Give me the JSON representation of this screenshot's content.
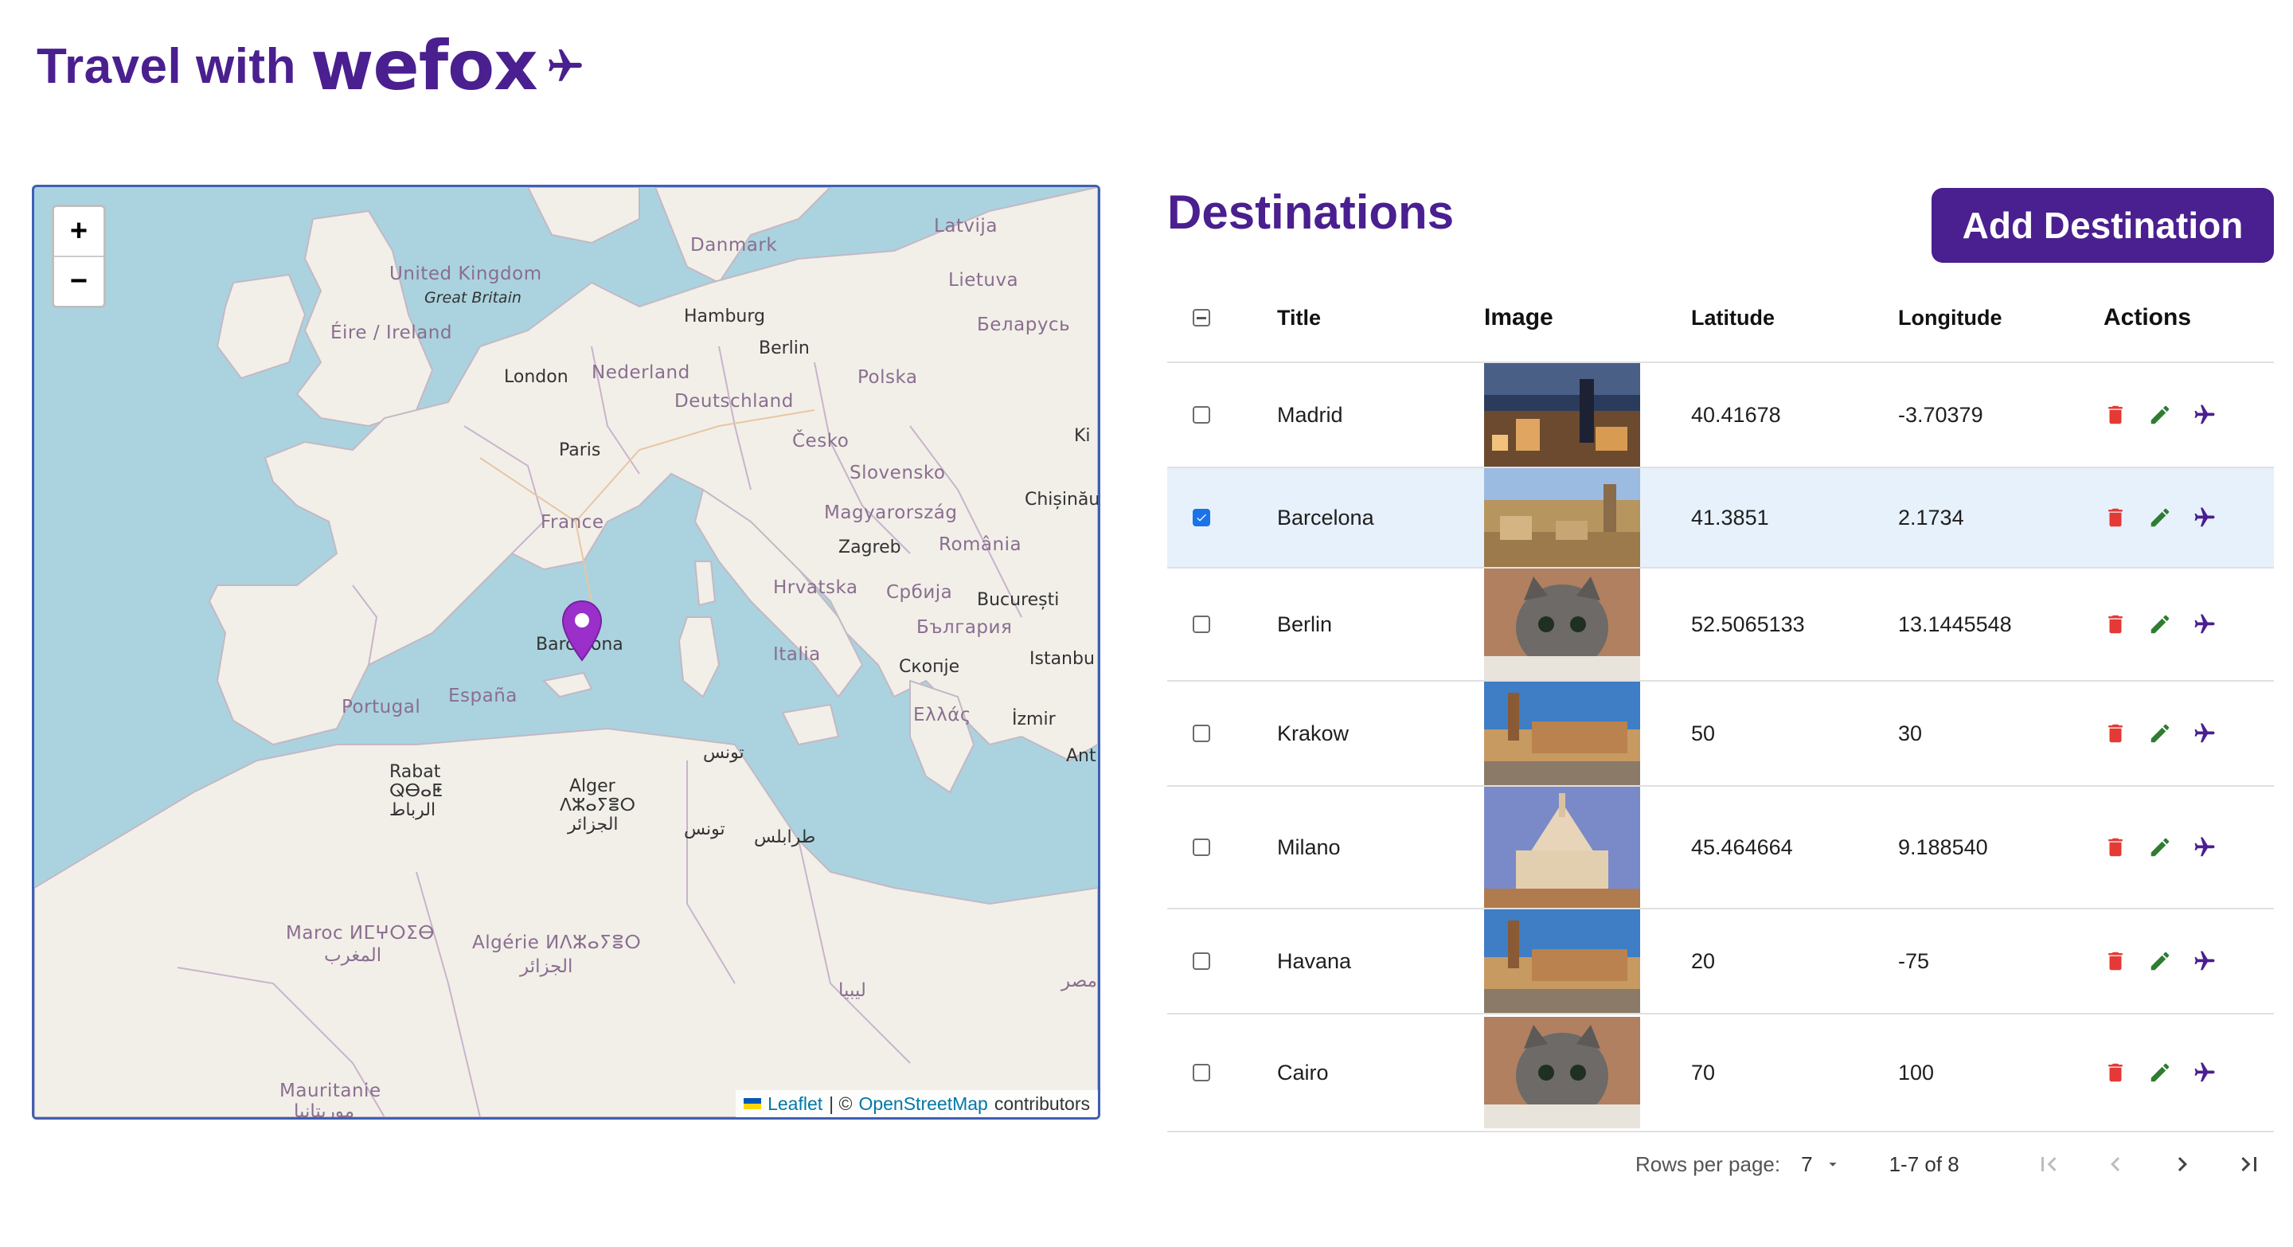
{
  "header": {
    "prefix": "Travel with",
    "brand": "wefox"
  },
  "map": {
    "zoom_in": "+",
    "zoom_out": "−",
    "attribution": {
      "leaflet": "Leaflet",
      "sep": "| ©",
      "osm": "OpenStreetMap",
      "suffix": "contributors"
    },
    "marker_label": "Barcelona",
    "labels": {
      "latvija": "Latvija",
      "danmark": "Danmark",
      "uk": "United Kingdom",
      "gb": "Great Britain",
      "lietuva": "Lietuva",
      "eire": "Éire / Ireland",
      "hamburg": "Hamburg",
      "berlin": "Berlin",
      "belarus": "Беларусь",
      "london": "London",
      "nederland": "Nederland",
      "polska": "Polska",
      "deutschland": "Deutschland",
      "cesko": "Česko",
      "paris": "Paris",
      "slovensko": "Slovensko",
      "chisinau": "Chișinău",
      "magyarorszag": "Magyarország",
      "france": "France",
      "zagreb": "Zagreb",
      "romania": "România",
      "hrvatska": "Hrvatska",
      "srbija": "Србија",
      "bucuresti": "București",
      "italia": "Italia",
      "bulgaria": "България",
      "istanbul": "Istanbu",
      "skopje": "Скопје",
      "espana": "España",
      "portugal": "Portugal",
      "ellas": "Ελλάς",
      "izmir": "İzmir",
      "tunis": "تونس",
      "ant": "Ant",
      "rabat": "Rabat",
      "rabat2": "ⵕⴱⴰⵟ",
      "rabat3": "الرباط",
      "alger": "Alger",
      "alger2": "ⴷⵣⴰⵢⴻⵔ",
      "alger3": "الجزائر",
      "tunis2": "تونس",
      "tripoli": "طرابلس",
      "maroc": "Maroc ⵍⵎⵖⵔⵉⴱ",
      "maroc2": "المغرب",
      "algerie": "Algérie ⵍⴷⵣⴰⵢⴻⵔ",
      "algerie2": "الجزائر",
      "libya": "ليبيا",
      "misr": "مصر",
      "mauritanie": "Mauritanie",
      "mauritanie2": "موريتانيا",
      "kiv": "Ki"
    }
  },
  "destinations": {
    "title": "Destinations",
    "add_button": "Add Destination",
    "columns": {
      "title": "Title",
      "image": "Image",
      "latitude": "Latitude",
      "longitude": "Longitude",
      "actions": "Actions"
    },
    "rows": [
      {
        "title": "Madrid",
        "latitude": "40.41678",
        "longitude": "-3.70379",
        "selected": false,
        "image": "city-night"
      },
      {
        "title": "Barcelona",
        "latitude": "41.3851",
        "longitude": "2.1734",
        "selected": true,
        "image": "city-day"
      },
      {
        "title": "Berlin",
        "latitude": "52.5065133",
        "longitude": "13.1445548",
        "selected": false,
        "image": "kitten"
      },
      {
        "title": "Krakow",
        "latitude": "50",
        "longitude": "30",
        "selected": false,
        "image": "cloth-hall"
      },
      {
        "title": "Milano",
        "latitude": "45.464664",
        "longitude": "9.188540",
        "selected": false,
        "image": "cathedral"
      },
      {
        "title": "Havana",
        "latitude": "20",
        "longitude": "-75",
        "selected": false,
        "image": "cloth-hall"
      },
      {
        "title": "Cairo",
        "latitude": "70",
        "longitude": "100",
        "selected": false,
        "image": "kitten"
      }
    ],
    "icons": {
      "delete": "trash-icon",
      "edit": "pencil-icon",
      "fly": "airplane-icon"
    },
    "colors": {
      "brand": "#4a1f8f",
      "delete": "#e53935",
      "edit": "#2e7d32",
      "selected_row": "#e7f1fb"
    }
  },
  "pagination": {
    "rows_per_page_label": "Rows per page:",
    "rows_per_page": "7",
    "range": "1-7 of 8"
  }
}
